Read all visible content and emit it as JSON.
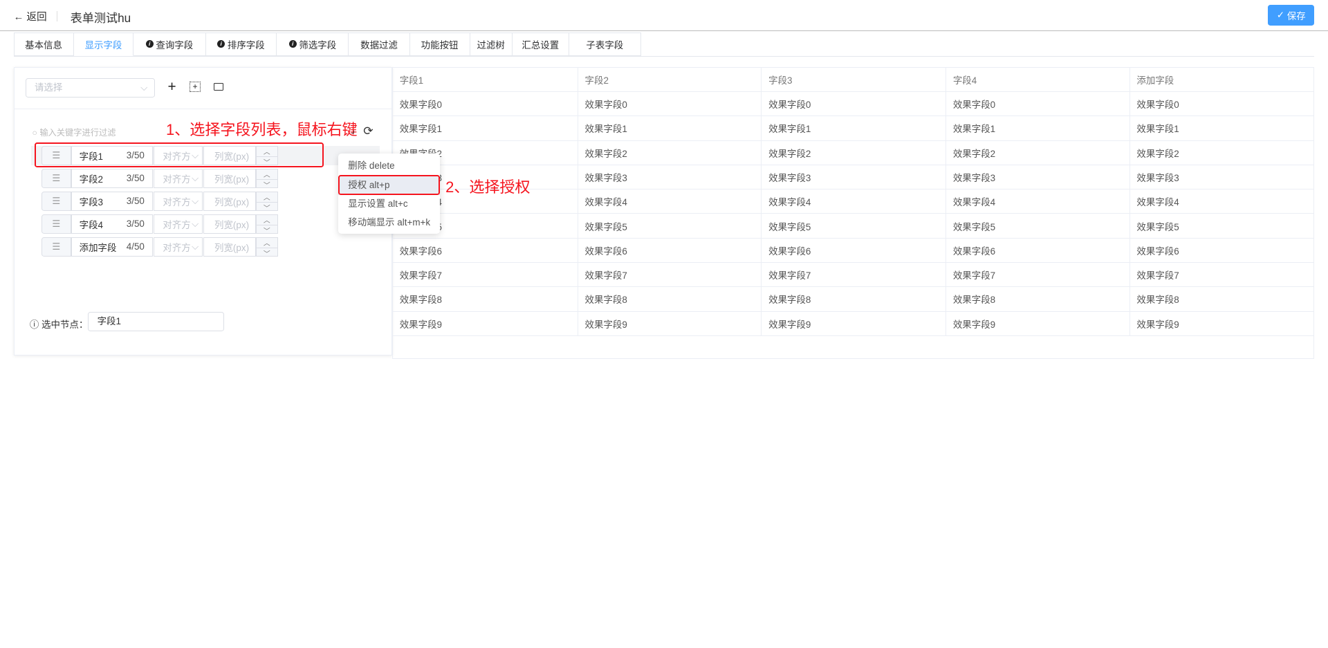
{
  "header": {
    "back_label": "返回",
    "title": "表单测试hu",
    "save_label": "保存"
  },
  "tabs": [
    {
      "label": "基本信息"
    },
    {
      "label": "显示字段",
      "active": true
    },
    {
      "label": "查询字段",
      "info": true
    },
    {
      "label": "排序字段",
      "info": true
    },
    {
      "label": "筛选字段",
      "info": true
    },
    {
      "label": "数据过滤"
    },
    {
      "label": "功能按钮"
    },
    {
      "label": "过滤树"
    },
    {
      "label": "汇总设置"
    },
    {
      "label": "子表字段"
    }
  ],
  "left_panel": {
    "select_placeholder": "请选择",
    "search_placeholder": "输入关键字进行过滤",
    "fields": [
      {
        "name": "字段1",
        "count": "3/50"
      },
      {
        "name": "字段2",
        "count": "3/50"
      },
      {
        "name": "字段3",
        "count": "3/50"
      },
      {
        "name": "字段4",
        "count": "3/50"
      },
      {
        "name": "添加字段",
        "count": "4/50"
      }
    ],
    "align_placeholder": "对齐方",
    "width_placeholder": "列宽(px)",
    "selected_label": "选中节点：",
    "selected_value": "字段1"
  },
  "context_menu": [
    "删除 delete",
    "授权 alt+p",
    "显示设置 alt+c",
    "移动端显示 alt+m+k"
  ],
  "annotations": {
    "step1": "1、选择字段列表，鼠标右键",
    "step2": "2、选择授权",
    "color": "#f5141e"
  },
  "table": {
    "headers": [
      "字段1",
      "字段2",
      "字段3",
      "字段4",
      "添加字段"
    ],
    "rows": [
      "效果字段0",
      "效果字段1",
      "效果字段2",
      "效果字段3",
      "效果字段4",
      "效果字段5",
      "效果字段6",
      "效果字段7",
      "效果字段8",
      "效果字段9"
    ]
  },
  "colors": {
    "primary": "#409eff"
  }
}
